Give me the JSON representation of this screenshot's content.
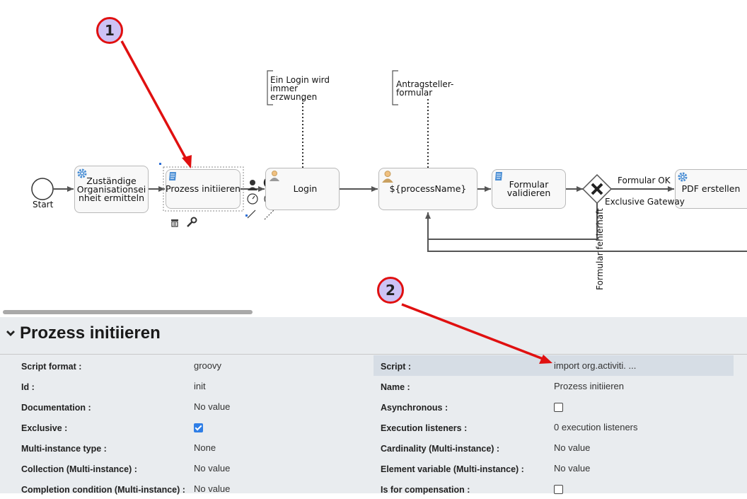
{
  "diagram": {
    "start_label": "Start",
    "tasks": [
      {
        "id": "t1",
        "label": "Zuständige\nOrganisationsei\nnheit ermitteln",
        "icon": "gear-icon"
      },
      {
        "id": "t2",
        "label": "Prozess initiieren",
        "icon": "script-icon"
      },
      {
        "id": "t3",
        "label": "Login",
        "icon": "user-icon"
      },
      {
        "id": "t4",
        "label": "${processName}",
        "icon": "user-icon"
      },
      {
        "id": "t5",
        "label": "Formular\nvalidieren",
        "icon": "script-icon"
      },
      {
        "id": "t6",
        "label": "PDF erstellen",
        "icon": "gear-icon"
      }
    ],
    "annotations": [
      {
        "id": "a1",
        "text": "Ein Login wird\nimmer\nerzwungen"
      },
      {
        "id": "a2",
        "text": "Antragsteller-\nformular"
      }
    ],
    "gateway_label": "Exclusive Gateway",
    "flow_ok_label": "Formular OK",
    "flow_error_label": "Formular fehlerhaft",
    "badges": [
      "1",
      "2"
    ]
  },
  "panel": {
    "title": "Prozess initiieren",
    "left": [
      {
        "label": "Script format :",
        "value": "groovy",
        "type": "text"
      },
      {
        "label": "Id :",
        "value": "init",
        "type": "text"
      },
      {
        "label": "Documentation :",
        "value": "No value",
        "type": "text"
      },
      {
        "label": "Exclusive :",
        "value": "checked",
        "type": "checkbox",
        "checked": true
      },
      {
        "label": "Multi-instance type :",
        "value": "None",
        "type": "text"
      },
      {
        "label": "Collection (Multi-instance) :",
        "value": "No value",
        "type": "text"
      },
      {
        "label": "Completion condition (Multi-instance) :",
        "value": "No value",
        "type": "text"
      }
    ],
    "right": [
      {
        "label": "Script :",
        "value": "import org.activiti. ...",
        "type": "text",
        "highlight": true
      },
      {
        "label": "Name :",
        "value": "Prozess initiieren",
        "type": "text"
      },
      {
        "label": "Asynchronous :",
        "value": "unchecked",
        "type": "checkbox",
        "checked": false
      },
      {
        "label": "Execution listeners :",
        "value": "0 execution listeners",
        "type": "text"
      },
      {
        "label": "Cardinality (Multi-instance) :",
        "value": "No value",
        "type": "text"
      },
      {
        "label": "Element variable (Multi-instance) :",
        "value": "No value",
        "type": "text"
      },
      {
        "label": "Is for compensation :",
        "value": "unchecked",
        "type": "checkbox",
        "checked": false
      }
    ]
  }
}
